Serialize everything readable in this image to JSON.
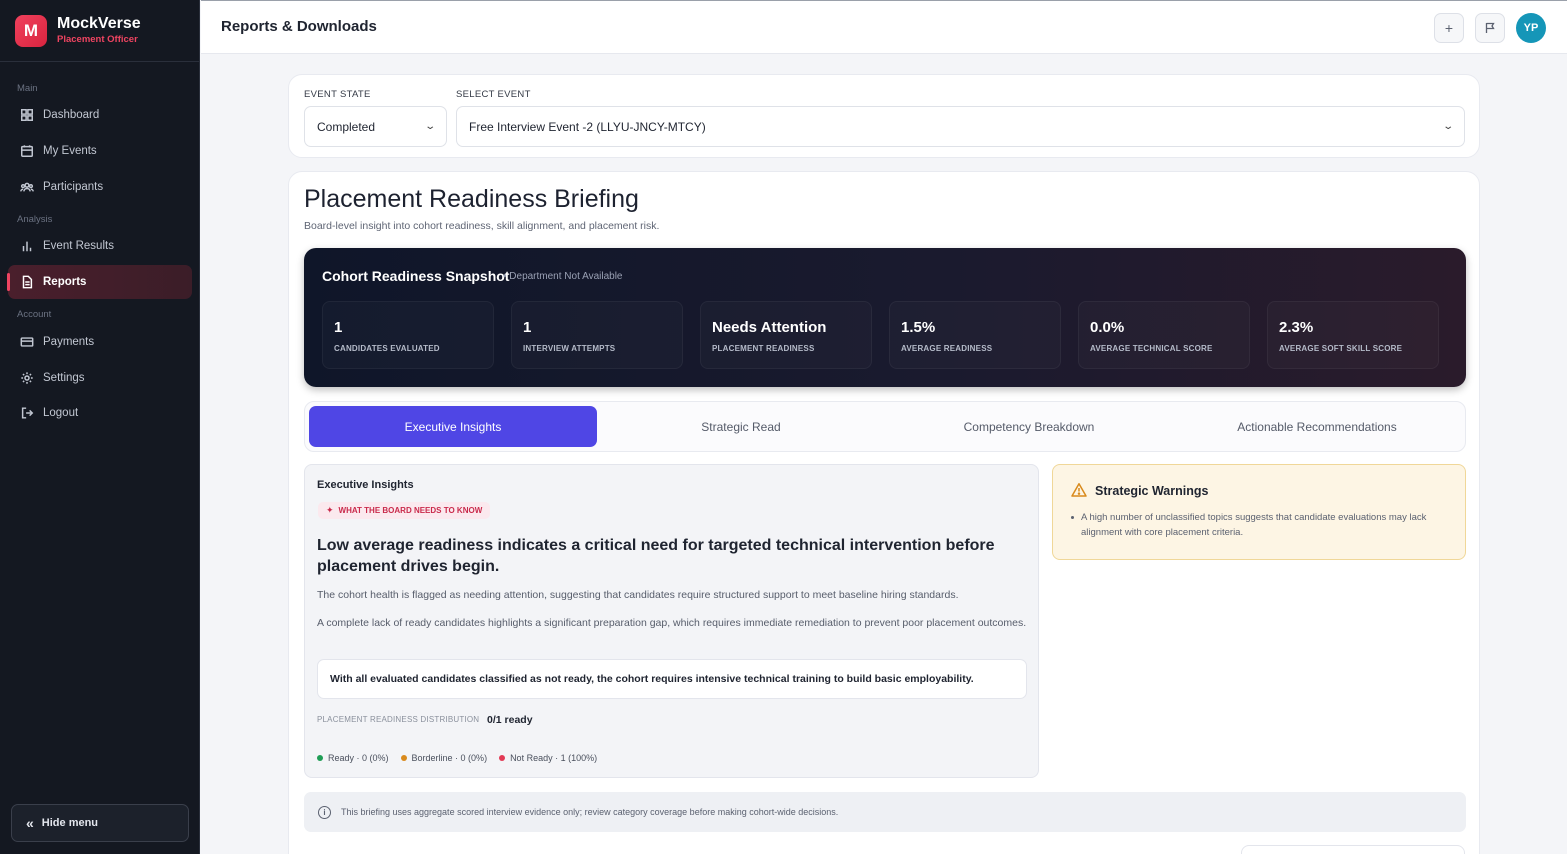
{
  "brand": {
    "logo_letter": "M",
    "name": "MockVerse",
    "role": "Placement Officer"
  },
  "sidebar": {
    "sections": {
      "main": "Main",
      "analysis": "Analysis",
      "account": "Account"
    },
    "items": [
      {
        "label": "Dashboard",
        "icon": "grid-icon"
      },
      {
        "label": "My Events",
        "icon": "calendar-icon"
      },
      {
        "label": "Participants",
        "icon": "users-icon"
      },
      {
        "label": "Event Results",
        "icon": "bar-chart-icon"
      },
      {
        "label": "Reports",
        "icon": "document-icon",
        "active": true
      },
      {
        "label": "Payments",
        "icon": "card-icon"
      },
      {
        "label": "Settings",
        "icon": "gear-icon"
      },
      {
        "label": "Logout",
        "icon": "logout-icon"
      }
    ],
    "hide_menu": "Hide menu"
  },
  "topbar": {
    "title": "Reports & Downloads",
    "avatar": "YP"
  },
  "filters": {
    "event_state_label": "EVENT STATE",
    "event_state_value": "Completed",
    "select_event_label": "SELECT EVENT",
    "select_event_value": "Free Interview Event -2 (LLYU-JNCY-MTCY)"
  },
  "briefing": {
    "title": "Placement Readiness Briefing",
    "subtitle": "Board-level insight into cohort readiness, skill alignment, and placement risk.",
    "snapshot_title": "Cohort Readiness Snapshot",
    "snapshot_dept": "• Department Not Available",
    "stats": [
      {
        "value": "1",
        "label": "CANDIDATES EVALUATED"
      },
      {
        "value": "1",
        "label": "INTERVIEW ATTEMPTS"
      },
      {
        "value": "Needs Attention",
        "label": "PLACEMENT READINESS"
      },
      {
        "value": "1.5%",
        "label": "AVERAGE READINESS"
      },
      {
        "value": "0.0%",
        "label": "AVERAGE TECHNICAL SCORE"
      },
      {
        "value": "2.3%",
        "label": "AVERAGE SOFT SKILL SCORE"
      }
    ],
    "tabs": [
      "Executive Insights",
      "Strategic Read",
      "Competency Breakdown",
      "Actionable Recommendations"
    ],
    "insights": {
      "heading": "Executive Insights",
      "pill": "WHAT THE BOARD NEEDS TO KNOW",
      "lead": "Low average readiness indicates a critical need for targeted technical intervention before placement drives begin.",
      "p1": "The cohort health is flagged as needing attention, suggesting that candidates require structured support to meet baseline hiring standards.",
      "p2": "A complete lack of ready candidates highlights a significant preparation gap, which requires immediate remediation to prevent poor placement outcomes.",
      "callout": "With all evaluated candidates classified as not ready, the cohort requires intensive technical training to build basic employability.",
      "distribution_label": "PLACEMENT READINESS DISTRIBUTION",
      "distribution_value": "0/1 ready",
      "legend": [
        {
          "label": "Ready · 0 (0%)",
          "color": "#1f9d55"
        },
        {
          "label": "Borderline · 0 (0%)",
          "color": "#d98a1c"
        },
        {
          "label": "Not Ready · 1 (100%)",
          "color": "#e23a55"
        }
      ]
    },
    "warnings": {
      "heading": "Strategic Warnings",
      "text": "A high number of unclassified topics suggests that candidate evaluations may lack alignment with core placement criteria."
    },
    "note": "This briefing uses aggregate scored interview evidence only; review category coverage before making cohort-wide decisions."
  },
  "colors": {
    "accent": "#4f46e5",
    "brand": "#ef4461",
    "warning_bg": "#fdf5e4"
  }
}
